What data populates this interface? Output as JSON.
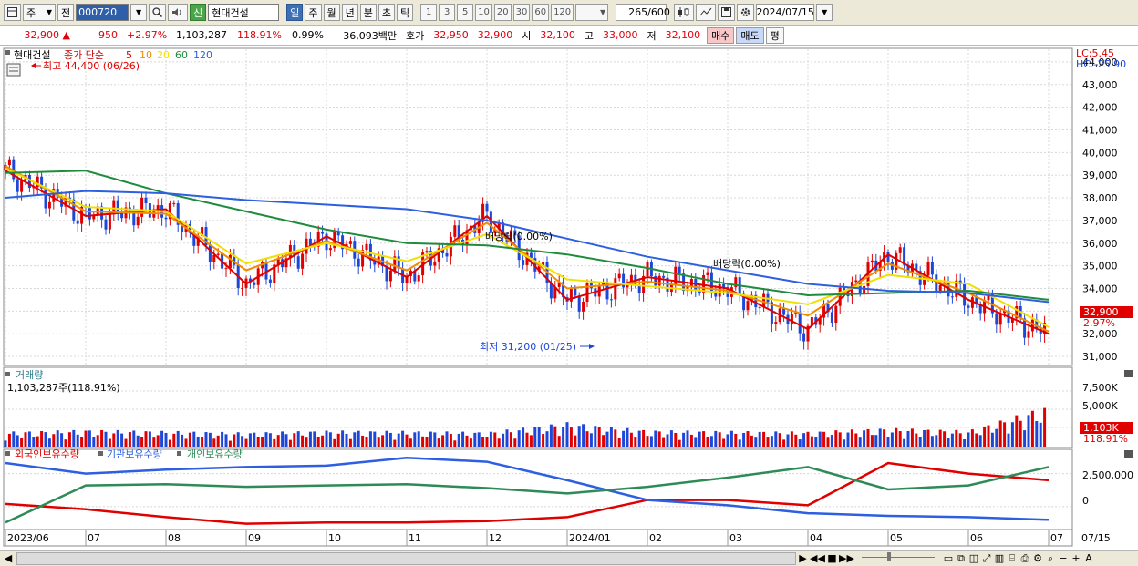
{
  "toolbar": {
    "menu_icon": "grid-icon",
    "type_select": "주",
    "prev_label": "전",
    "stock_code": "000720",
    "new_badge": "신",
    "stock_name": "현대건설",
    "period_buttons": [
      "일",
      "주",
      "월",
      "년",
      "분",
      "초",
      "틱"
    ],
    "selected_period": "일",
    "interval_buttons": [
      "1",
      "3",
      "5",
      "10",
      "20",
      "30",
      "60",
      "120"
    ],
    "count_display": "265",
    "count_max": "/600",
    "date": "2024/07/15"
  },
  "info": {
    "price": "32,900",
    "change": "950",
    "change_pct": "+2.97%",
    "volume": "1,103,287",
    "volume_ratio": "118.91%",
    "turnover_rate": "0.99%",
    "amount": "36,093백만",
    "ask_label": "호가",
    "ask1": "32,950",
    "ask2": "32,900",
    "open_label": "시",
    "open": "32,100",
    "high_label": "고",
    "high": "33,000",
    "low_label": "저",
    "low": "32,100",
    "buy_label": "매수",
    "sell_label": "매도",
    "avg_label": "평"
  },
  "price_panel": {
    "stock_name": "현대건설",
    "ma_title": "종가 단순",
    "ma_periods": [
      "5",
      "10",
      "20",
      "60",
      "120"
    ],
    "ma_colors": [
      "#e00000",
      "#f08c00",
      "#f0e000",
      "#1e8c3c",
      "#2d5fe0"
    ],
    "lc_label": "LC:5.45",
    "hc_label": "HC:-25.90",
    "high_annot": "최고 44,400 (06/26)",
    "low_annot": "최저 31,200 (01/25)",
    "div_annot_1": "배당락(0.00%)",
    "div_annot_2": "배당락(0.00%)",
    "price_tag": "32,900",
    "pct_tag": "2.97%",
    "y_ticks": [
      "44,000",
      "43,000",
      "42,000",
      "41,000",
      "40,000",
      "39,000",
      "38,000",
      "37,000",
      "36,000",
      "35,000",
      "34,000",
      "33,000",
      "32,000",
      "31,000"
    ]
  },
  "volume_panel": {
    "title": "거래량",
    "value_label": "1,103,287주(118.91%)",
    "y_ticks": [
      "7,500K",
      "5,000K"
    ],
    "vol_tag": "1,103K",
    "pct_tag": "118.91%"
  },
  "holding_panel": {
    "series_labels": [
      "외국인보유수량",
      "기관보유수량",
      "개인보유수량"
    ],
    "series_colors": [
      "#e00000",
      "#2d5fe0",
      "#2e8b57"
    ],
    "y_ticks": [
      "2,500,000",
      "0"
    ]
  },
  "x_axis": {
    "labels": [
      "2023/06",
      "07",
      "08",
      "09",
      "10",
      "11",
      "12",
      "2024/01",
      "02",
      "03",
      "04",
      "05",
      "06",
      "07"
    ],
    "right_label": "07/15"
  },
  "chart_data": {
    "type": "line",
    "ylim": [
      30600,
      44600
    ],
    "x": [
      "2023/06",
      "07",
      "08",
      "09",
      "10",
      "11",
      "12",
      "2024/01",
      "02",
      "03",
      "04",
      "05",
      "06",
      "07"
    ],
    "series": [
      {
        "name": "5",
        "values": [
          39200,
          37200,
          37500,
          34200,
          36300,
          34500,
          37200,
          33500,
          34500,
          34000,
          32200,
          35500,
          33500,
          32000
        ]
      },
      {
        "name": "10",
        "values": [
          39400,
          37400,
          37300,
          34800,
          36100,
          34800,
          36900,
          34000,
          34300,
          33900,
          32800,
          35100,
          33800,
          32100
        ]
      },
      {
        "name": "20",
        "values": [
          39300,
          37600,
          37400,
          35100,
          36000,
          35200,
          36400,
          34400,
          34100,
          33800,
          33300,
          34600,
          34200,
          32300
        ]
      },
      {
        "name": "60",
        "values": [
          39100,
          39200,
          38200,
          37400,
          36600,
          36000,
          35900,
          35500,
          34900,
          34200,
          33700,
          33800,
          33900,
          33500
        ]
      },
      {
        "name": "120",
        "values": [
          38000,
          38300,
          38200,
          37900,
          37700,
          37500,
          37000,
          36200,
          35400,
          34800,
          34200,
          33900,
          33800,
          33400
        ]
      }
    ],
    "volume_k": [
      400,
      450,
      420,
      380,
      430,
      420,
      390,
      650,
      440,
      420,
      400,
      500,
      430,
      1103
    ],
    "holdings": {
      "foreign": [
        200000,
        -200000,
        -800000,
        -1300000,
        -1200000,
        -1200000,
        -1100000,
        -800000,
        500000,
        500000,
        100000,
        3300000,
        2500000,
        2000000
      ],
      "institution": [
        3300000,
        2500000,
        2800000,
        3000000,
        3100000,
        3700000,
        3400000,
        2000000,
        500000,
        100000,
        -500000,
        -700000,
        -800000,
        -1000000
      ],
      "individual": [
        -1200000,
        1600000,
        1700000,
        1500000,
        1600000,
        1700000,
        1400000,
        1000000,
        1500000,
        2200000,
        3000000,
        1300000,
        1600000,
        3000000
      ]
    }
  },
  "bottom": {
    "nav_icons": [
      "play-icon",
      "rewind-icon",
      "stop-icon",
      "fast-forward-icon"
    ],
    "zoom_minus": "−",
    "zoom_plus": "+",
    "font_label": "A"
  }
}
